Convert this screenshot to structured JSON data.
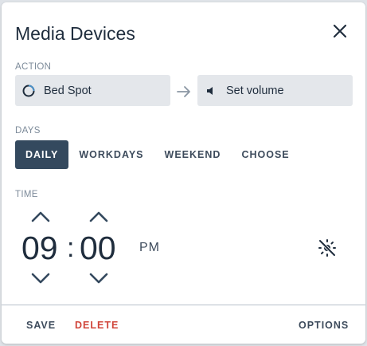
{
  "dialog": {
    "title": "Media Devices",
    "close_icon": "close-icon"
  },
  "action": {
    "label": "ACTION",
    "device": "Bed Spot",
    "device_icon": "speaker-ring-icon",
    "arrow_icon": "arrow-right-icon",
    "command": "Set volume",
    "command_icon": "volume-icon"
  },
  "days": {
    "label": "DAYS",
    "options": [
      "DAILY",
      "WORKDAYS",
      "WEEKEND",
      "CHOOSE"
    ],
    "selected": "DAILY"
  },
  "time": {
    "label": "TIME",
    "hour": "09",
    "separator": ":",
    "minute": "00",
    "period": "PM",
    "sun_icon": "sun-off-icon"
  },
  "footer": {
    "save": "SAVE",
    "delete": "DELETE",
    "options": "OPTIONS"
  },
  "colors": {
    "accent": "#34495e",
    "danger": "#d0453a",
    "muted": "#7d8b9a",
    "field_bg": "#e4e7eb"
  }
}
